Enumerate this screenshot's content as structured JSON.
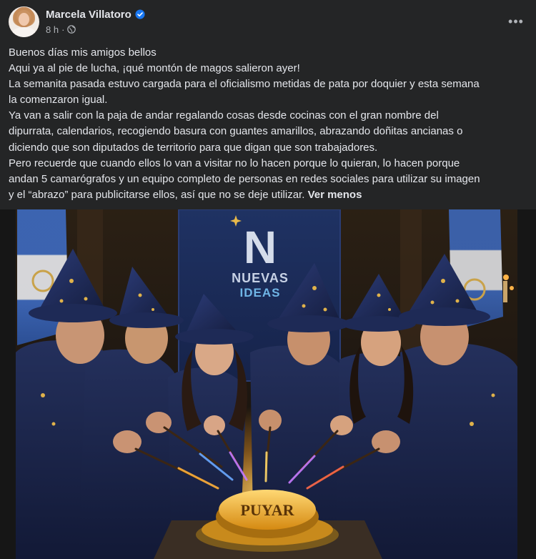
{
  "post": {
    "author": "Marcela Villatoro",
    "time": "8 h",
    "separator": "·",
    "more_label": "•••",
    "lines": [
      "Buenos días mis amigos bellos",
      "Aqui ya al pie de lucha, ¡qué montón de magos salieron ayer!",
      "La semanita pasada estuvo cargada para el oficialismo metidas de pata por doquier y esta semana",
      "la comenzaron igual.",
      "Ya van a salir con la paja de andar regalando cosas desde cocinas con el gran nombre del",
      "dipurrata, calendarios, recogiendo basura con guantes amarillos, abrazando doñitas ancianas  o",
      "diciendo que son diputados de territorio para que digan que son trabajadores.",
      "Pero recuerde que cuando ellos lo van a visitar no lo hacen porque lo quieran, lo hacen porque",
      "andan 5 camarógrafos y un equipo completo de personas en redes sociales para utilizar su imagen"
    ],
    "last_line": "y el “abrazo” para publicitarse ellos, así que no se deje utilizar.",
    "see_less": "Ver menos"
  },
  "image": {
    "banner_letter": "N",
    "banner_line1": "NUEVAS",
    "banner_line2": "IDEAS",
    "button_text": "PUYAR"
  },
  "colors": {
    "background": "#242526",
    "text": "#e4e6eb",
    "secondary": "#b0b3b8",
    "verified": "#1877f2",
    "robe": "#1c2548",
    "banner": "#1d2d5a",
    "gold": "#f2b53a"
  }
}
